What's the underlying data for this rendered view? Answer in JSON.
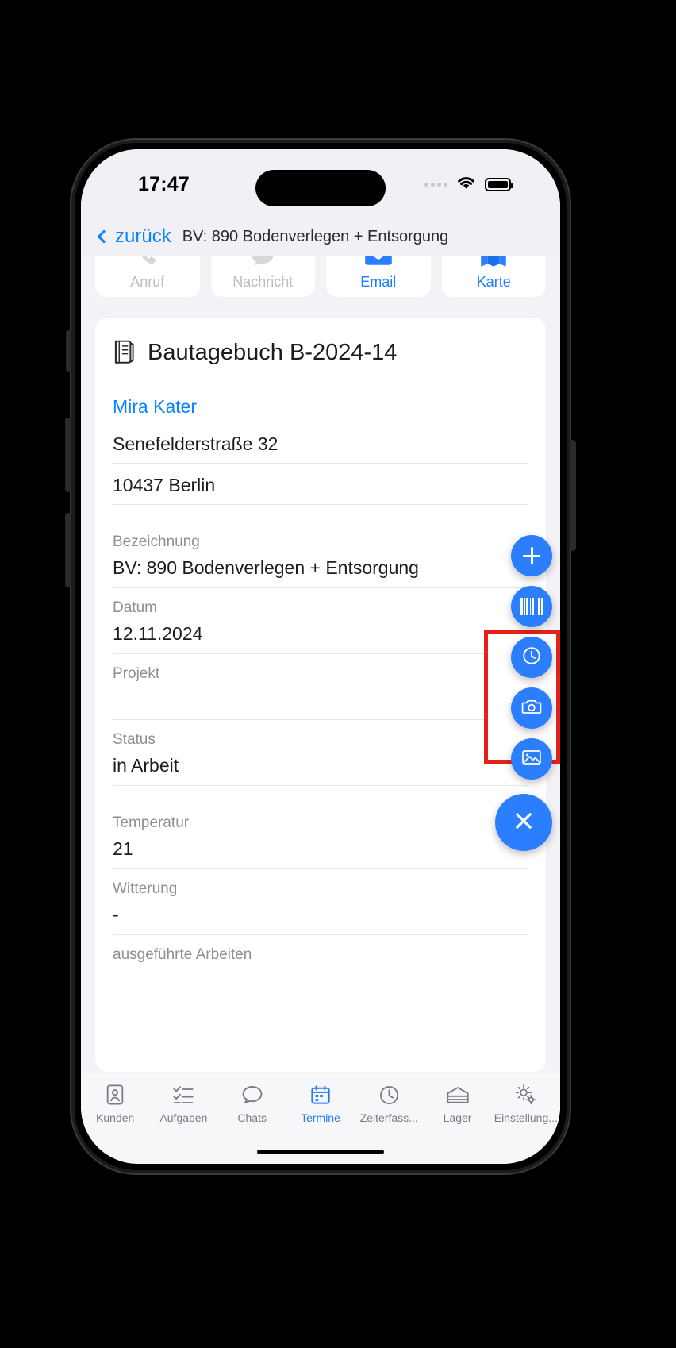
{
  "theme": {
    "accent": "#0a84ff",
    "fab_blue": "#2b7fff",
    "annotation_red": "#e8201a",
    "label_gray": "#8e8e93",
    "screen_bg": "#f2f2f7"
  },
  "status_bar": {
    "time": "17:47",
    "cell_icon": "cellular-dots-icon",
    "wifi_icon": "wifi-icon",
    "battery_icon": "battery-full-icon"
  },
  "nav": {
    "back_icon": "chevron-left-icon",
    "back_label": "zurück",
    "title": "BV: 890 Bodenverlegen + Entsorgung"
  },
  "tiles": [
    {
      "label": "Anruf",
      "icon": "phone-icon",
      "state": "disabled"
    },
    {
      "label": "Nachricht",
      "icon": "chat-bubble-icon",
      "state": "disabled"
    },
    {
      "label": "Email",
      "icon": "envelope-icon",
      "state": "active"
    },
    {
      "label": "Karte",
      "icon": "map-icon",
      "state": "active"
    }
  ],
  "card": {
    "title_icon": "journal-book-icon",
    "title": "Bautagebuch B-2024-14",
    "contact_name": "Mira Kater",
    "address_street": "Senefelderstraße 32",
    "address_city": "10437 Berlin",
    "fields": [
      {
        "label": "Bezeichnung",
        "value": "BV: 890 Bodenverlegen + Entsorgung"
      },
      {
        "label": "Datum",
        "value": "12.11.2024"
      },
      {
        "label": "Projekt",
        "value": ""
      },
      {
        "label": "Status",
        "value": "in Arbeit"
      },
      {
        "label": "Temperatur",
        "value": "21"
      },
      {
        "label": "Witterung",
        "value": "-"
      },
      {
        "label": "ausgeführte Arbeiten",
        "value": ""
      }
    ]
  },
  "fabs": [
    {
      "name": "add-fab",
      "icon": "plus-icon"
    },
    {
      "name": "barcode-scan-fab",
      "icon": "barcode-icon"
    },
    {
      "name": "time-tracking-fab",
      "icon": "clock-icon"
    },
    {
      "name": "camera-fab",
      "icon": "camera-icon"
    },
    {
      "name": "gallery-fab",
      "icon": "photo-image-icon"
    },
    {
      "name": "close-fab",
      "icon": "close-x-icon"
    }
  ],
  "annotation": {
    "type": "highlight-rectangle",
    "color": "#e8201a",
    "targets": [
      "camera-fab",
      "gallery-fab"
    ]
  },
  "tabbar": [
    {
      "label": "Kunden",
      "icon": "contact-card-icon",
      "selected": false
    },
    {
      "label": "Aufgaben",
      "icon": "checklist-icon",
      "selected": false
    },
    {
      "label": "Chats",
      "icon": "chat-bubble-icon",
      "selected": false
    },
    {
      "label": "Termine",
      "icon": "calendar-icon",
      "selected": true
    },
    {
      "label": "Zeiterfass...",
      "icon": "clock-icon",
      "selected": false
    },
    {
      "label": "Lager",
      "icon": "warehouse-icon",
      "selected": false
    },
    {
      "label": "Einstellung...",
      "icon": "gears-icon",
      "selected": false
    }
  ]
}
